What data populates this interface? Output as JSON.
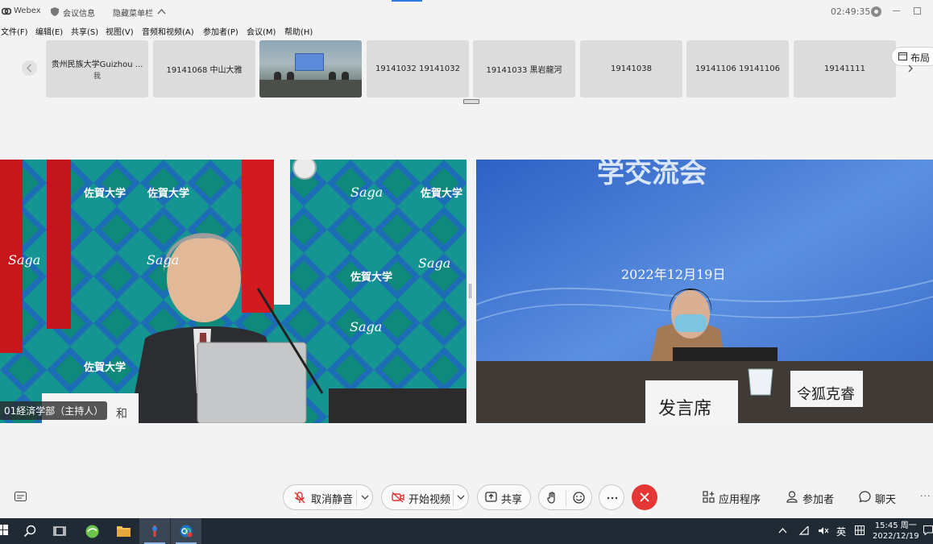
{
  "window": {
    "app_name": "Webex",
    "meeting_info": "会议信息",
    "hide_menu": "隐藏菜单栏",
    "elapsed_time": "02:49:35"
  },
  "menu": [
    "文件(F)",
    "编辑(E)",
    "共享(S)",
    "视图(V)",
    "音频和视频(A)",
    "参加者(P)",
    "会议(M)",
    "帮助(H)"
  ],
  "participants": [
    {
      "name": "贵州民族大学Guizhou ...",
      "sub": "我"
    },
    {
      "name": "19141068 中山大雅",
      "sub": ""
    },
    {
      "name": "",
      "sub": "",
      "video": true
    },
    {
      "name": "19141032 19141032",
      "sub": ""
    },
    {
      "name": "19141033 黒岩龍河",
      "sub": ""
    },
    {
      "name": "19141038",
      "sub": ""
    },
    {
      "name": "19141106 19141106",
      "sub": ""
    },
    {
      "name": "19141111",
      "sub": ""
    }
  ],
  "layout_label": "布局",
  "main_videos": {
    "left": {
      "name_tag": "01経済学部（主持人）",
      "banner_texts": [
        "佐賀大学",
        "Saga"
      ],
      "desk_sign": "和"
    },
    "right": {
      "banner_title": "学交流会",
      "banner_date": "2022年12月19日",
      "speaker_sign": "发言席",
      "name_sign": "令狐克睿"
    }
  },
  "controls": {
    "unmute": "取消静音",
    "start_video": "开始视频",
    "share": "共享",
    "apps": "应用程序",
    "participants": "参加者",
    "chat": "聊天",
    "more": "···"
  },
  "taskbar": {
    "ime": "英",
    "time": "15:45 周一",
    "date": "2022/12/19"
  },
  "colors": {
    "accent": "#2d7be0",
    "end_call": "#e63535",
    "taskbar": "#1f2a35"
  }
}
